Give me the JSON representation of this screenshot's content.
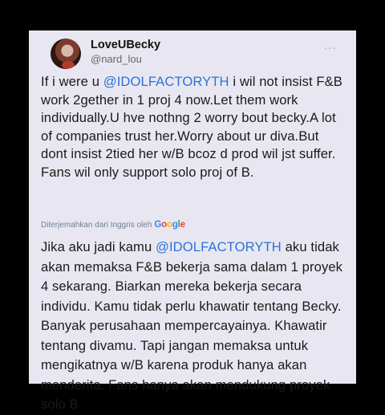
{
  "author": {
    "display_name": "LoveUBecky",
    "handle": "@nard_lou"
  },
  "more_label": "···",
  "tweet": {
    "line1_before": "If i were u ",
    "mention": "@IDOLFACTORYTH",
    "line1_after": " i wil not insist",
    "rest": "F&B work 2gether in 1 proj 4 now.Let them work individually.U hve nothng 2 worry bout becky.A lot of companies trust her.Worry about ur diva.But dont insist 2tied her w/B bcoz d prod wil jst suffer. Fans wil only support solo proj of B."
  },
  "translation_notice": {
    "label": "Diterjemahkan dari Inggris oleh",
    "google": [
      "G",
      "o",
      "o",
      "g",
      "l",
      "e"
    ]
  },
  "translation": {
    "before": "Jika aku jadi kamu ",
    "mention": "@IDOLFACTORYTH",
    "after": " aku tidak akan memaksa F&B bekerja sama dalam 1 proyek 4 sekarang. Biarkan mereka bekerja secara individu. Kamu tidak perlu khawatir tentang Becky. Banyak perusahaan mempercayainya. Khawatir tentang divamu. Tapi jangan memaksa untuk mengikatnya w/B karena produk hanya akan menderita. Fans hanya akan mendukung proyek solo B."
  },
  "colors": {
    "card_bg": "#e8e7f1",
    "mention": "#2a73d9",
    "background": "#000000"
  },
  "icons": [
    "avatar-photo",
    "more-options-icon",
    "google-logo"
  ]
}
